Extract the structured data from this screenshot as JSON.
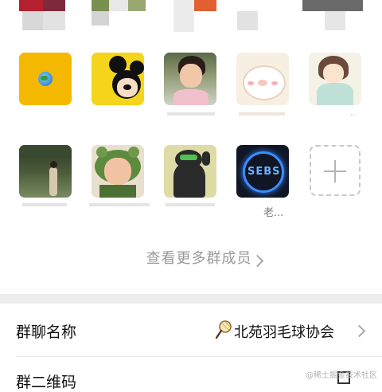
{
  "members_preview": {
    "view_more_label": "查看更多群成员",
    "nickname_fragment": "老..."
  },
  "members": [
    {
      "name": "globe-avatar"
    },
    {
      "name": "mickey-avatar"
    },
    {
      "name": "baby-girl-avatar"
    },
    {
      "name": "cartoon-pig-avatar"
    },
    {
      "name": "anime-girl-avatar"
    },
    {
      "name": "woman-outdoor-avatar"
    },
    {
      "name": "frog-hat-baby-avatar"
    },
    {
      "name": "black-dog-avatar"
    },
    {
      "name": "sebs-logo-avatar"
    }
  ],
  "settings": {
    "group_name_label": "群聊名称",
    "group_name_value": "北苑羽毛球协会",
    "qr_label": "群二维码"
  },
  "watermark": "@稀土掘金技术社区",
  "colors": {
    "globe_bg": "#f5b800",
    "mickey_bg": "#f4d51c",
    "separator": "#ededed",
    "muted_text": "#9a9a9a"
  }
}
